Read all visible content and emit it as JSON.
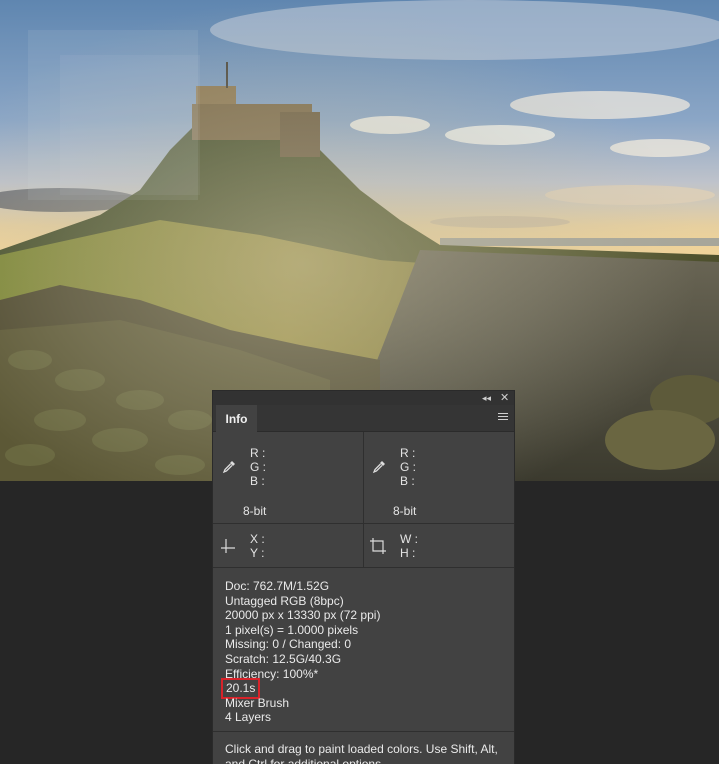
{
  "panel": {
    "tab_label": "Info",
    "collapse_icon": "double-chevron-left-icon",
    "close_icon": "close-icon",
    "menu_icon": "panel-menu-icon"
  },
  "color_readout_1": {
    "icon": "eyedropper-icon",
    "r": "R :",
    "g": "G :",
    "b": "B :",
    "mode": "8-bit"
  },
  "color_readout_2": {
    "icon": "eyedropper-icon",
    "r": "R :",
    "g": "G :",
    "b": "B :",
    "mode": "8-bit"
  },
  "position_readout": {
    "icon": "crosshair-icon",
    "x": "X :",
    "y": "Y :"
  },
  "size_readout": {
    "icon": "selection-marquee-icon",
    "w": "W :",
    "h": "H :"
  },
  "document": {
    "doc": "Doc: 762.7M/1.52G",
    "profile": "Untagged RGB (8bpc)",
    "dimensions": "20000 px x 13330 px (72 ppi)",
    "pixel_ratio": "1 pixel(s) = 1.0000 pixels",
    "missing_changed": "Missing: 0 / Changed: 0",
    "scratch": "Scratch: 12.5G/40.3G",
    "efficiency": "Efficiency: 100%*",
    "timing": "20.1s",
    "current_tool": "Mixer Brush",
    "layers": "4 Layers"
  },
  "tool_hint": "Click and drag to paint loaded colors.  Use Shift, Alt, and Ctrl for additional options.",
  "colors": {
    "highlight": "#d8232a",
    "panel_bg": "#424242",
    "app_bg": "#262626"
  }
}
